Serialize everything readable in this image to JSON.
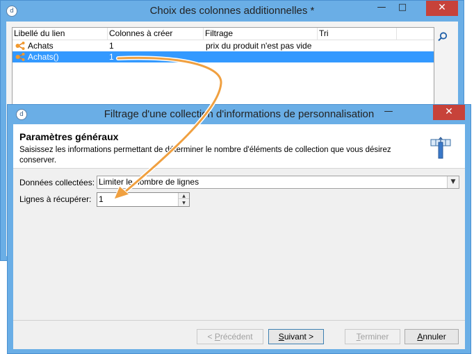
{
  "back_window": {
    "title": "Choix des colonnes additionnelles *",
    "columns": [
      "Libellé du lien",
      "Colonnes à créer",
      "Filtrage",
      "Tri"
    ],
    "rows": [
      {
        "label": "Achats",
        "columns": "1",
        "filter": "prix du produit n'est pas vide",
        "sort": "",
        "selected": false
      },
      {
        "label": "Achats()",
        "columns": "1",
        "filter": "",
        "sort": "",
        "selected": true
      }
    ],
    "search_icon": "search-icon"
  },
  "front_window": {
    "title": "Filtrage d'une collection d'informations de personnalisation",
    "header_title": "Paramètres généraux",
    "header_desc": "Saisissez les informations permettant de déterminer le nombre d'éléments de collection que vous désirez conserver.",
    "collected_label": "Données collectées:",
    "collected_value": "Limiter le nombre de lignes",
    "lines_label": "Lignes à récupérer:",
    "lines_value": "1",
    "buttons": {
      "previous": {
        "prefix": "< ",
        "accel": "P",
        "rest": "récédent"
      },
      "next": {
        "accel": "S",
        "rest": "uivant >"
      },
      "finish": {
        "accel": "T",
        "rest": "erminer"
      },
      "cancel": {
        "accel": "A",
        "rest": "nnuler"
      }
    }
  },
  "colors": {
    "title_bar": "#6aaee6",
    "close": "#c7423a",
    "selection": "#3399ff",
    "arrow": "#f0a040"
  }
}
